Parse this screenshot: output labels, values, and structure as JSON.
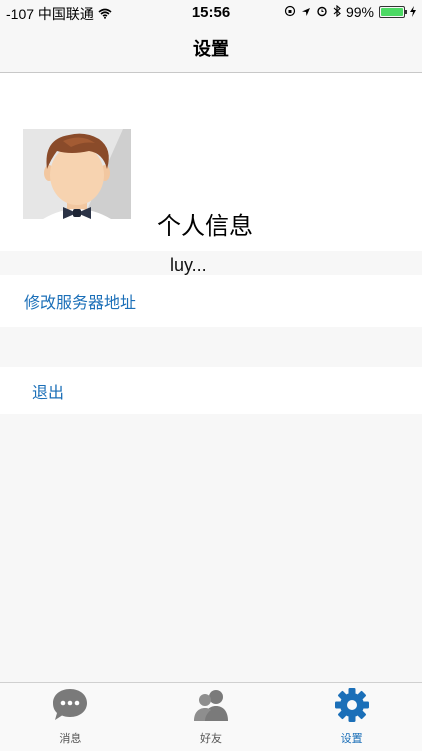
{
  "status_bar": {
    "carrier": "-107 中国联通",
    "time": "15:56",
    "battery_percent": "99%",
    "battery_level": 0.99
  },
  "nav": {
    "title": "设置"
  },
  "profile": {
    "name": "个人信息",
    "subtitle": "luy..."
  },
  "menu": {
    "server_label": "修改服务器地址",
    "logout_label": "退出"
  },
  "tabs": [
    {
      "label": "消息",
      "icon": "chat-bubble-icon",
      "active": false
    },
    {
      "label": "好友",
      "icon": "friends-icon",
      "active": false
    },
    {
      "label": "设置",
      "icon": "gear-icon",
      "active": true
    }
  ],
  "colors": {
    "accent": "#1b6fb8",
    "tab_inactive": "#7a7a7a",
    "battery": "#4cd964"
  }
}
